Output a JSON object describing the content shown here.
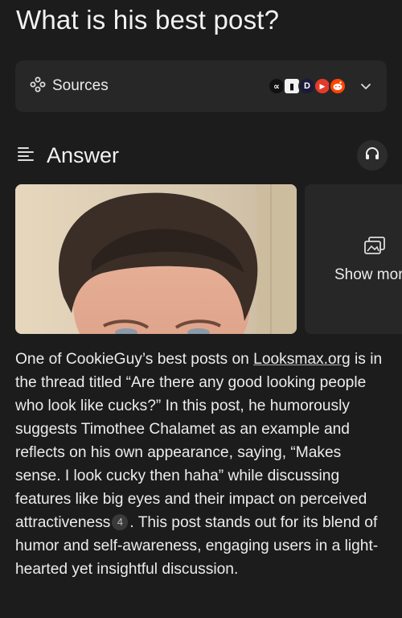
{
  "question": "What is his best post?",
  "sources": {
    "label": "Sources",
    "icons": [
      "looksmax-icon",
      "bar-icon",
      "d-icon",
      "youtube-icon",
      "reddit-icon"
    ],
    "colors": {
      "looksmax": "#111111",
      "bar": "#f2f2f2",
      "d": "#1a1a3a",
      "youtube": "#e33b2a",
      "reddit": "#ff4500"
    }
  },
  "answer": {
    "title": "Answer",
    "show_more": "Show more",
    "text": {
      "p1": "One of CookieGuy’s best posts on ",
      "link": "Looksmax.org",
      "p2": " is in the thread titled “Are there any good looking people who look like cucks?” In this post, he humorously suggests Timothee Chalamet as an example and reflects on his own appearance, saying, “Makes sense. I look cucky then haha” while discussing features like big eyes and their impact on perceived attractiveness",
      "citation": "4",
      "p3": ". This post stands out for its blend of humor and self-awareness, engaging users in a light-hearted yet insightful discussion."
    }
  }
}
